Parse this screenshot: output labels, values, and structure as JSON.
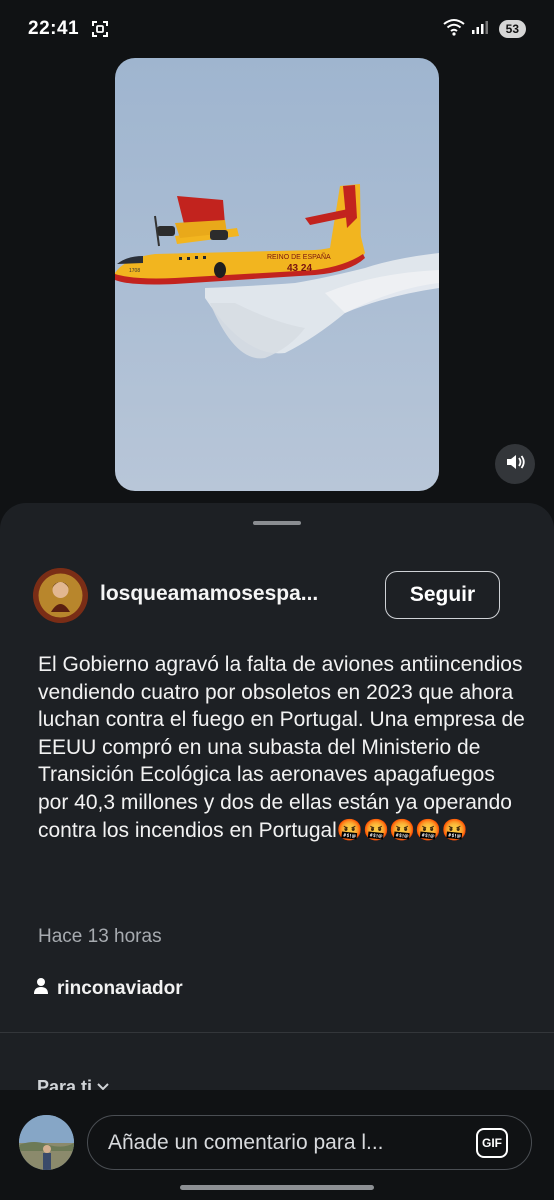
{
  "status_bar": {
    "time": "22:41",
    "battery": "53",
    "icons": [
      "screenshot-icon",
      "wifi-icon",
      "signal-icon",
      "battery-icon"
    ]
  },
  "video": {
    "plane_marking_top": "REINO DE ESPAÑA",
    "plane_marking_number": "43 24",
    "plane_marking_nose": "1708",
    "icons": [
      "volume-icon"
    ]
  },
  "post": {
    "username": "losqueamamosespa...",
    "follow_label": "Seguir",
    "caption": "El Gobierno agravó la falta de aviones antiincendios vendiendo cuatro por obsoletos en 2023 que ahora luchan contra el fuego en Portugal. Una empresa de EEUU compró en una subasta del Ministerio de Transición Ecológica las aeronaves apagafuegos por 40,3 millones y dos de ellas están ya operando contra los incendios en Portugal🤬🤬🤬🤬🤬",
    "timestamp": "Hace 13 horas",
    "credit_name": "rinconaviador",
    "section_label": "Para ti"
  },
  "comment_bar": {
    "placeholder": "Añade un comentario para l...",
    "gif_label": "GIF"
  },
  "colors": {
    "background": "#101214",
    "sheet": "#1d2024",
    "plane_yellow": "#f2b51f",
    "plane_red": "#c2231e"
  }
}
